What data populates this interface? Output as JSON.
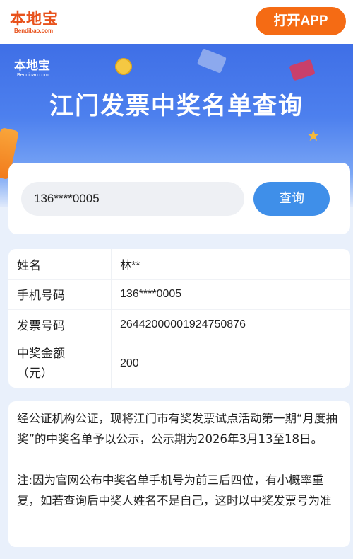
{
  "header": {
    "logo_cn": "本地宝",
    "logo_en": "Bendibao.com",
    "open_app_label": "打开APP"
  },
  "banner": {
    "logo_cn": "本地宝",
    "logo_en": "Bendibao.com",
    "title": "江门发票中奖名单查询"
  },
  "search": {
    "value": "136****0005",
    "button_label": "查询"
  },
  "result": {
    "rows": [
      {
        "label": "姓名",
        "value": "林**"
      },
      {
        "label": "手机号码",
        "value": "136****0005"
      },
      {
        "label": "发票号码",
        "value": "26442000001924750876"
      },
      {
        "label": "中奖金额（元）",
        "value": "200"
      }
    ]
  },
  "notice": {
    "paragraph1": "经公证机构公证，现将江门市有奖发票试点活动第一期“月度抽奖”的中奖名单予以公示，公示期为2026年3月13至18日。",
    "paragraph2": "注:因为官网公布中奖名单手机号为前三后四位，有小概率重复，如若查询后中奖人姓名不是自己，这时以中奖发票号为准"
  },
  "colors": {
    "brand_orange": "#f56b14",
    "banner_blue": "#4d80ee",
    "button_blue": "#3f8fe9"
  }
}
